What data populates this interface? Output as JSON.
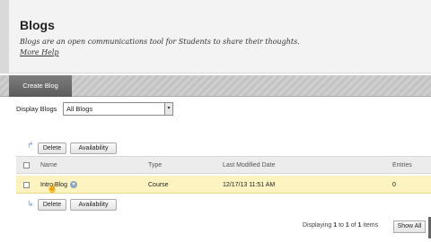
{
  "header": {
    "title": "Blogs",
    "description": "Blogs are an open communications tool for Students to share their thoughts.",
    "more_help": "More Help"
  },
  "action_bar": {
    "create_label": "Create Blog"
  },
  "filter": {
    "label": "Display Blogs",
    "selected": "All Blogs",
    "arrow": "▾"
  },
  "top_buttons": {
    "delete": "Delete",
    "availability": "Availability"
  },
  "bottom_buttons": {
    "delete": "Delete",
    "availability": "Availability"
  },
  "table": {
    "columns": [
      "Name",
      "Type",
      "Last Modified Date",
      "Entries"
    ],
    "rows": [
      {
        "name": "Intro Blog",
        "type": "Course",
        "modified": "12/17/13 11:51 AM",
        "entries": "0"
      }
    ]
  },
  "paging": {
    "prefix": "Displaying ",
    "from": "1",
    "to_word": " to ",
    "to": "1",
    "of_word": " of ",
    "total": "1",
    "suffix": " items"
  },
  "show_all": "Show All",
  "colors": {
    "row_highlight": "#fdf3c0",
    "action_bar": "#c9c9c9",
    "create_button": "#5b5b5b"
  },
  "icons": {
    "reorder_arrow_top": "↱",
    "reorder_arrow_bottom": "↳",
    "context_menu": "chevron-down-icon",
    "cursor": "hand-cursor-icon"
  }
}
